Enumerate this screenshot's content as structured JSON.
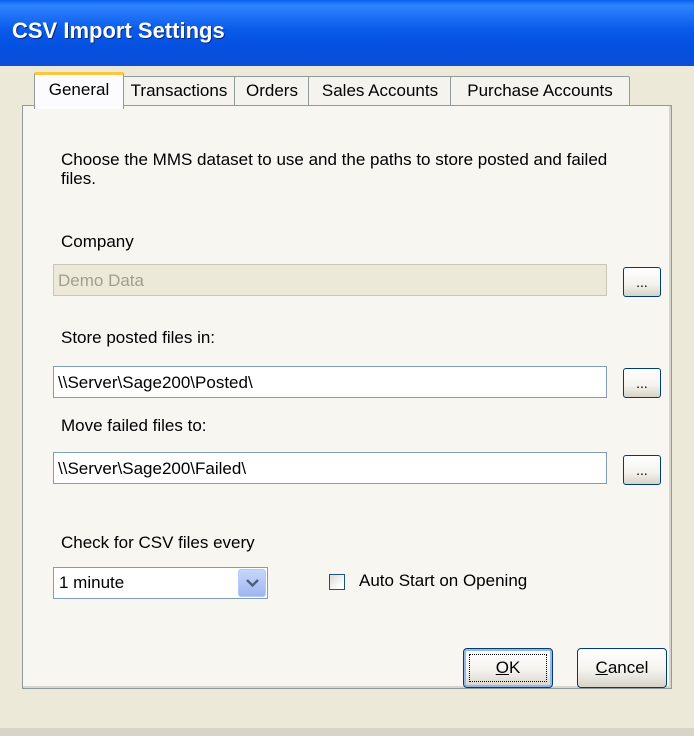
{
  "window": {
    "title": "CSV Import Settings"
  },
  "tabs": [
    {
      "label": "General",
      "active": true
    },
    {
      "label": "Transactions",
      "active": false
    },
    {
      "label": "Orders",
      "active": false
    },
    {
      "label": "Sales Accounts",
      "active": false
    },
    {
      "label": "Purchase Accounts",
      "active": false
    }
  ],
  "general": {
    "description": "Choose the MMS dataset to use and the paths to store posted and failed files.",
    "company_label": "Company",
    "company_value": "Demo Data",
    "posted_label": "Store posted files in:",
    "posted_value": "\\\\Server\\Sage200\\Posted\\",
    "failed_label": "Move failed files to:",
    "failed_value": "\\\\Server\\Sage200\\Failed\\",
    "browse_label": "...",
    "interval_label": "Check for CSV files every",
    "interval_value": "1 minute",
    "autostart_label": "Auto Start on Opening",
    "autostart_checked": false
  },
  "buttons": {
    "ok_key": "O",
    "ok_rest": "K",
    "cancel_key": "C",
    "cancel_rest": "ancel"
  },
  "colors": {
    "titlebar": "#0A5BEA",
    "dialog_bg": "#ECE9D8",
    "tab_highlight": "#FFC83C"
  }
}
